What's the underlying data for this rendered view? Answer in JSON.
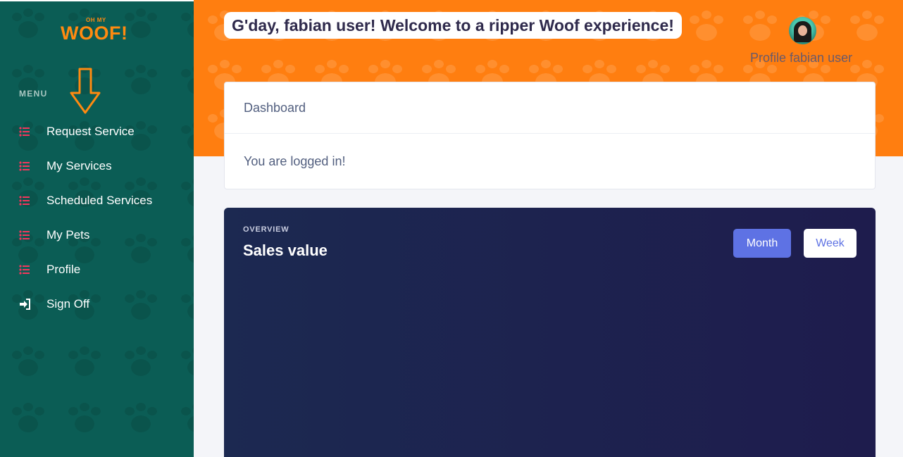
{
  "brand": {
    "logo_small": "OH MY",
    "logo_big": "WOOF!",
    "accent": "#ff7e10",
    "sidebar_color": "#0b5d55"
  },
  "sidebar": {
    "heading": "MENU",
    "items": [
      {
        "label": "Request Service",
        "icon": "list-icon"
      },
      {
        "label": "My Services",
        "icon": "list-icon"
      },
      {
        "label": "Scheduled Services",
        "icon": "list-icon"
      },
      {
        "label": "My Pets",
        "icon": "list-icon"
      },
      {
        "label": "Profile",
        "icon": "list-icon"
      },
      {
        "label": "Sign Off",
        "icon": "sign-out-icon"
      }
    ]
  },
  "header": {
    "greeting": "G'day, fabian user! Welcome to a ripper Woof experience!",
    "profile_label": "Profile fabian user"
  },
  "card": {
    "title": "Dashboard",
    "message": "You are logged in!"
  },
  "chart_panel": {
    "overline": "OVERVIEW",
    "title": "Sales value",
    "buttons": {
      "month": "Month",
      "week": "Week"
    },
    "active_button": "Month"
  }
}
